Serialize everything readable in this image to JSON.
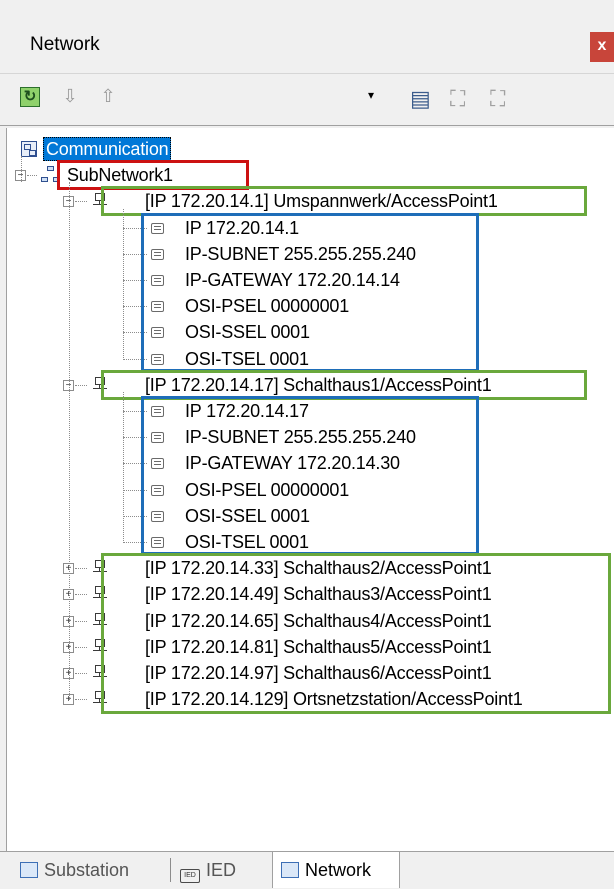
{
  "window": {
    "title": "Network",
    "close_label": "x"
  },
  "toolbar": {
    "refresh_icon": "refresh-icon",
    "move_down_icon": "arrow-down-icon",
    "move_up_icon": "arrow-up-icon",
    "combo_value": "",
    "combo_arrow": "▾"
  },
  "tree": {
    "root": "Communication",
    "subnetwork": "SubNetwork1",
    "access_points": [
      {
        "label": "[IP 172.20.14.1] Umspannwerk/AccessPoint1",
        "expanded": true,
        "properties": [
          "IP 172.20.14.1",
          "IP-SUBNET 255.255.255.240",
          "IP-GATEWAY 172.20.14.14",
          "OSI-PSEL 00000001",
          "OSI-SSEL 0001",
          "OSI-TSEL 0001"
        ]
      },
      {
        "label": "[IP 172.20.14.17] Schalthaus1/AccessPoint1",
        "expanded": true,
        "properties": [
          "IP 172.20.14.17",
          "IP-SUBNET 255.255.255.240",
          "IP-GATEWAY 172.20.14.30",
          "OSI-PSEL 00000001",
          "OSI-SSEL 0001",
          "OSI-TSEL 0001"
        ]
      },
      {
        "label": "[IP 172.20.14.33] Schalthaus2/AccessPoint1",
        "expanded": false
      },
      {
        "label": "[IP 172.20.14.49] Schalthaus3/AccessPoint1",
        "expanded": false
      },
      {
        "label": "[IP 172.20.14.65] Schalthaus4/AccessPoint1",
        "expanded": false
      },
      {
        "label": "[IP 172.20.14.81] Schalthaus5/AccessPoint1",
        "expanded": false
      },
      {
        "label": "[IP 172.20.14.97] Schalthaus6/AccessPoint1",
        "expanded": false
      },
      {
        "label": "[IP 172.20.14.129] Ortsnetzstation/AccessPoint1",
        "expanded": false
      }
    ]
  },
  "tabs": [
    {
      "label": "Substation",
      "active": false
    },
    {
      "label": "IED",
      "active": false
    },
    {
      "label": "Network",
      "active": true
    }
  ],
  "colors": {
    "selection": "#0078d7",
    "highlight_red": "#cc1111",
    "highlight_green": "#6aa83c",
    "highlight_blue": "#1e6db8",
    "close_button": "#c8453a"
  }
}
